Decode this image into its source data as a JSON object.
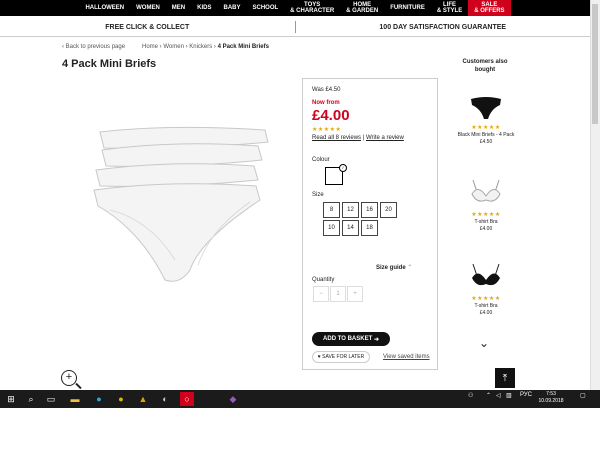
{
  "nav": {
    "items": [
      {
        "label": "HALLOWEEN",
        "red": false
      },
      {
        "label": "WOMEN",
        "red": false
      },
      {
        "label": "MEN",
        "red": false
      },
      {
        "label": "KIDS",
        "red": false
      },
      {
        "label": "BABY",
        "red": false
      },
      {
        "label": "SCHOOL",
        "red": false
      },
      {
        "label": "TOYS\n& CHARACTER",
        "red": false
      },
      {
        "label": "HOME\n& GARDEN",
        "red": false
      },
      {
        "label": "FURNITURE",
        "red": false
      },
      {
        "label": "LIFE\n& STYLE",
        "red": false
      },
      {
        "label": "SALE\n& OFFERS",
        "red": true
      }
    ]
  },
  "banner": {
    "left": "FREE CLICK & COLLECT",
    "right": "100 DAY SATISFACTION GUARANTEE"
  },
  "breadcrumb": {
    "back": "‹ Back to previous page",
    "path": "Home › Women › Knickers ›",
    "current": "4 Pack Mini Briefs"
  },
  "product": {
    "title": "4 Pack Mini Briefs",
    "was": "Was £4.50",
    "now_label": "Now from",
    "price": "£4.00",
    "rating_stars": "★★★★★",
    "rating_value": 4.5,
    "reviews_link": "Read all 8 reviews",
    "review_sep": " | ",
    "write_review": "Write a review",
    "colour_label": "Colour",
    "size_label": "Size",
    "sizes": [
      "8",
      "12",
      "16",
      "20",
      "10",
      "14",
      "18"
    ],
    "size_guide": "Size guide",
    "quantity_label": "Quantity",
    "quantity_value": "1",
    "add_to_basket": "ADD TO BASKET",
    "save_for_later": "SAVE FOR LATER",
    "view_saved": "View saved items"
  },
  "rail": {
    "title": "Customers also bought",
    "items": [
      {
        "name": "Black Mini Briefs - 4 Pack",
        "price": "£4.50",
        "stars": "★★★★★"
      },
      {
        "name": "T-shirt Bra",
        "price": "£4.00",
        "stars": "★★★★★"
      },
      {
        "name": "T-shirt Bra",
        "price": "£4.00",
        "stars": "★★★★★"
      }
    ]
  },
  "taskbar": {
    "lang": "РУС",
    "time": "7:53",
    "date": "10.09.2018"
  },
  "colors": {
    "accent_red": "#d0021b",
    "star": "#e8a800",
    "nav_bg": "#000000"
  }
}
